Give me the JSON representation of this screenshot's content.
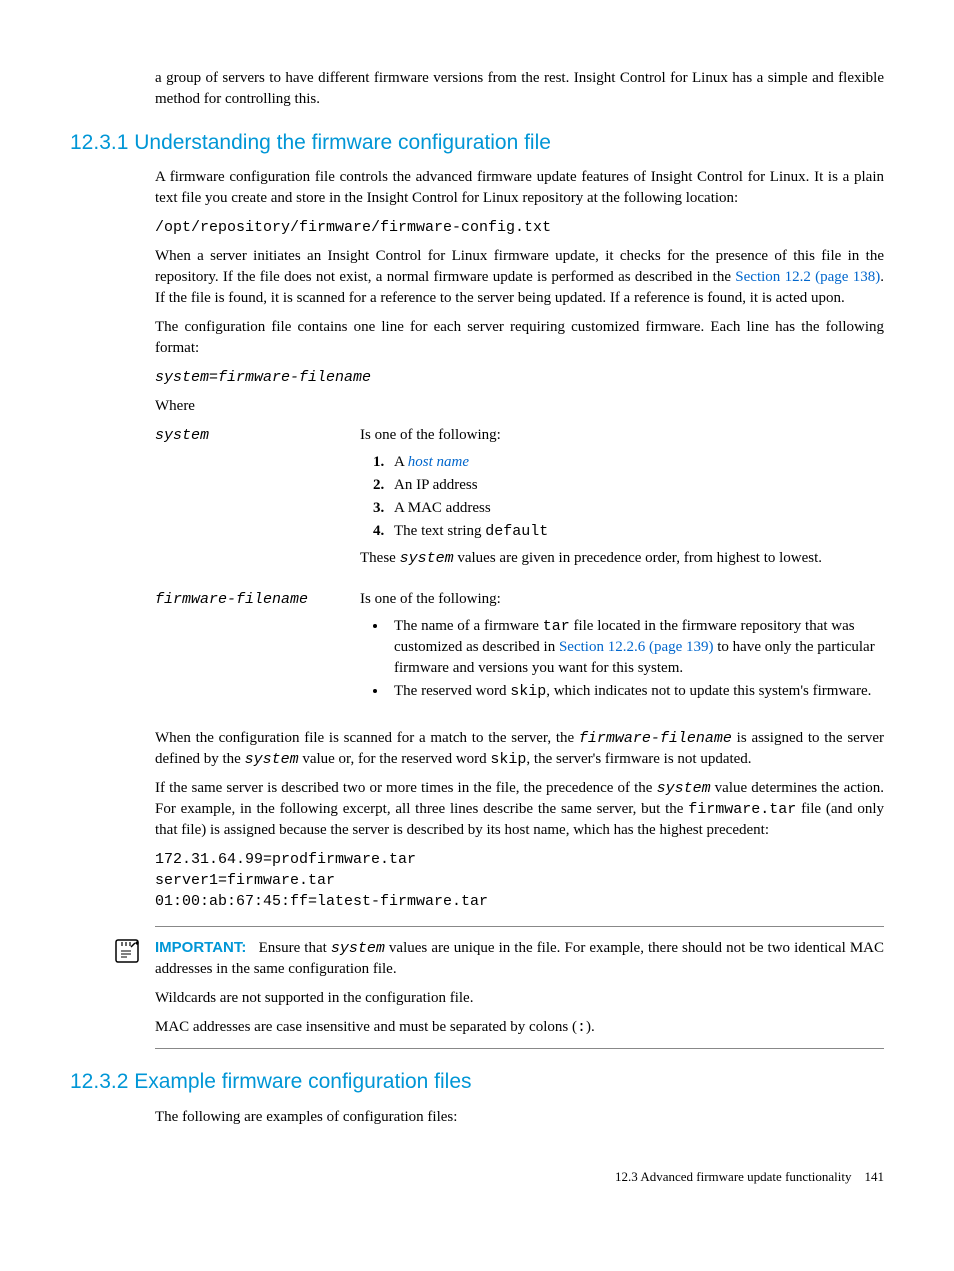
{
  "intro_para": "a group of servers to have different firmware versions from the rest. Insight Control for Linux has a simple and flexible method for controlling this.",
  "s1": {
    "heading": "12.3.1 Understanding the firmware configuration file",
    "p1": "A firmware configuration file controls the advanced firmware update features of Insight Control for Linux. It is a plain text file you create and store in the Insight Control for Linux repository at the following location:",
    "path": "/opt/repository/firmware/firmware-config.txt",
    "p2a": "When a server initiates an Insight Control for Linux firmware update, it checks for the presence of this file in the repository. If the file does not exist, a normal firmware update is performed as described in the ",
    "p2_link": "Section 12.2 (page 138)",
    "p2b": ". If the file is found, it is scanned for a reference to the server being updated. If a reference is found, it is acted upon.",
    "p3": "The configuration file contains one line for each server requiring customized firmware. Each line has the following format:",
    "format_line_a": "system",
    "format_line_eq": "=",
    "format_line_b": "firmware-filename",
    "where": "Where",
    "system_term": "system",
    "system_intro": "Is one of the following:",
    "system_li1a": "A ",
    "system_li1b": "host name",
    "system_li2": "An IP address",
    "system_li3": "A MAC address",
    "system_li4a": "The text string ",
    "system_li4b": "default",
    "system_note_a": "These ",
    "system_note_b": "system",
    "system_note_c": " values are given in precedence order, from highest to lowest.",
    "ff_term": "firmware-filename",
    "ff_intro": "Is one of the following:",
    "ff_li1a": "The name of a firmware ",
    "ff_li1b": "tar",
    "ff_li1c": " file located in the firmware repository that was customized as described in ",
    "ff_li1_link": "Section 12.2.6 (page 139)",
    "ff_li1d": " to have only the particular firmware and versions you want for this system.",
    "ff_li2a": "The reserved word ",
    "ff_li2b": "skip",
    "ff_li2c": ", which indicates not to update this system's firmware.",
    "p4a": "When the configuration file is scanned for a match to the server, the ",
    "p4b": "firmware-filename",
    "p4c": " is assigned to the server defined by the ",
    "p4d": "system",
    "p4e": " value or, for the reserved word ",
    "p4f": "skip",
    "p4g": ", the server's firmware is not updated.",
    "p5a": "If the same server is described two or more times in the file, the precedence of the ",
    "p5b": "system",
    "p5c": " value determines the action. For example, in the following excerpt, all three lines describe the same server, but the ",
    "p5d": "firmware.tar",
    "p5e": " file (and only that file) is assigned because the server is described by its host name, which has the highest precedent:",
    "codeblock": "172.31.64.99=prodfirmware.tar\nserver1=firmware.tar\n01:00:ab:67:45:ff=latest-firmware.tar",
    "important_label": "IMPORTANT:",
    "imp_p1a": "Ensure that ",
    "imp_p1b": "system",
    "imp_p1c": " values are unique in the file. For example, there should not be two identical MAC addresses in the same configuration file.",
    "imp_p2": "Wildcards are not supported in the configuration file.",
    "imp_p3a": "MAC addresses are case insensitive and must be separated by colons (",
    "imp_p3b": ":",
    "imp_p3c": ")."
  },
  "s2": {
    "heading": "12.3.2 Example firmware configuration files",
    "p1": "The following are examples of configuration files:"
  },
  "footer": {
    "text": "12.3 Advanced firmware update functionality",
    "page": "141"
  }
}
